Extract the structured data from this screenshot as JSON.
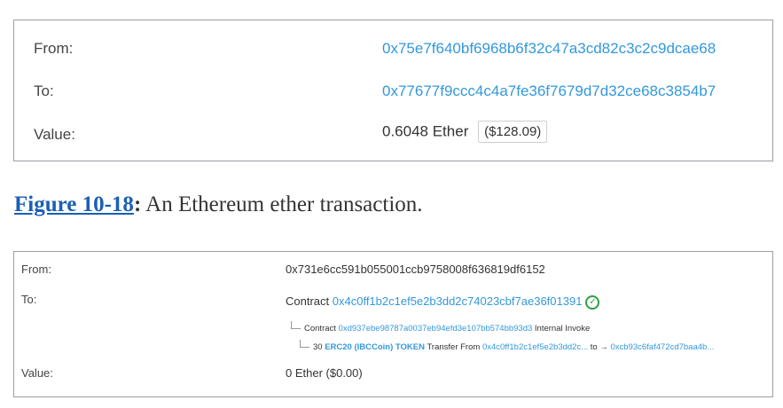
{
  "panel1": {
    "from_label": "From:",
    "from_address": "0x75e7f640bf6968b6f32c47a3cd82c3c2c9dcae68",
    "to_label": "To:",
    "to_address": "0x77677f9ccc4c4a7fe36f7679d7d32ce68c3854b7",
    "value_label": "Value:",
    "value_amount": "0.6048 Ether",
    "value_usd": "($128.09)"
  },
  "caption": {
    "figure_ref": "Figure 10-18",
    "colon": ":",
    "text": " An Ethereum ether transaction."
  },
  "panel2": {
    "from_label": "From:",
    "from_address": "0x731e6cc591b055001ccb9758008f636819df6152",
    "to_label": "To:",
    "to_prefix": "Contract ",
    "to_contract": "0x4c0ff1b2c1ef5e2b3dd2c74023cbf7ae36f01391",
    "check_icon": "check-circle-icon",
    "internal": {
      "prefix": "Contract ",
      "address": "0xd937ebe98787a0037eb94efd3e107bb574bb93d3",
      "suffix": " Internal Invoke"
    },
    "transfer": {
      "amount": "30 ",
      "token": "ERC20 (IBCCoin) TOKEN",
      "middle": " Transfer From ",
      "from_short": "0x4c0ff1b2c1ef5e2b3dd2c...",
      "to_text": " to → ",
      "to_short": "0xcb93c6faf472cd7baa4b..."
    },
    "value_label": "Value:",
    "value_amount": "0 Ether ($0.00)"
  },
  "colors": {
    "link": "#3498db",
    "figure_link": "#1a5fb4",
    "check": "#2e9e44",
    "border": "#9aa0a6"
  }
}
